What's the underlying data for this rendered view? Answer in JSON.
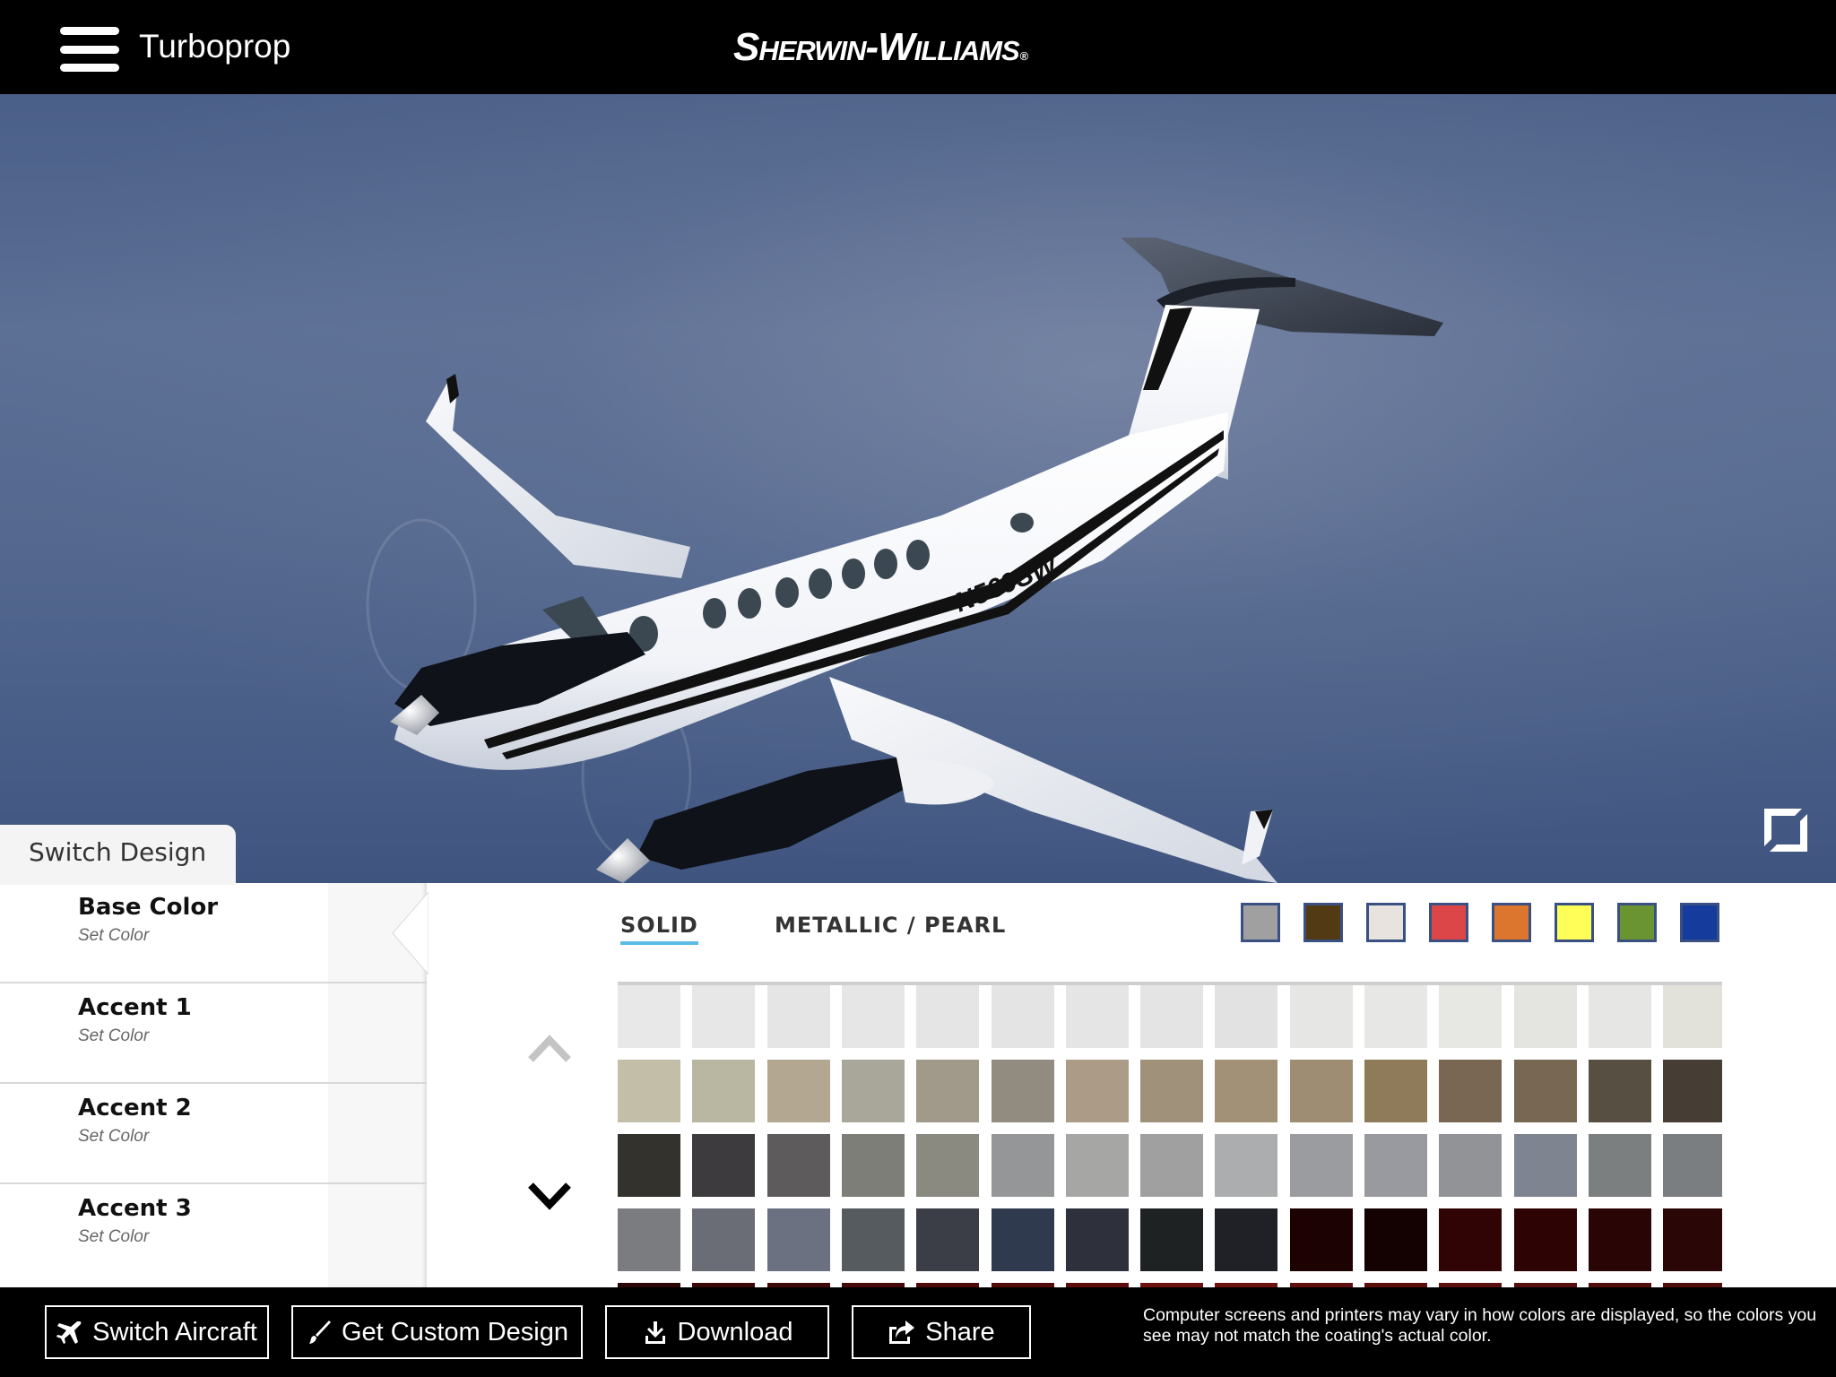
{
  "header": {
    "menu_icon": "hamburger-menu-icon",
    "title": "Turboprop",
    "brand": "Sherwin-Williams",
    "brand_mark": "®"
  },
  "viewport": {
    "aircraft_registration": "N569SW",
    "fullscreen_icon": "expand-icon",
    "switch_design_label": "Switch Design"
  },
  "sidebar": {
    "items": [
      {
        "label": "Base Color",
        "sub": "Set Color",
        "active": true
      },
      {
        "label": "Accent 1",
        "sub": "Set Color",
        "active": false
      },
      {
        "label": "Accent 2",
        "sub": "Set Color",
        "active": false
      },
      {
        "label": "Accent 3",
        "sub": "Set Color",
        "active": false
      }
    ]
  },
  "palette": {
    "tabs": [
      {
        "label": "SOLID",
        "active": true
      },
      {
        "label": "METALLIC / PEARL",
        "active": false
      }
    ],
    "accent_color": "#5bbbe4",
    "quick_filters": [
      {
        "name": "gray",
        "color": "#a0a0a0"
      },
      {
        "name": "brown",
        "color": "#523a14"
      },
      {
        "name": "white",
        "color": "#e8e3de"
      },
      {
        "name": "red",
        "color": "#dc4649"
      },
      {
        "name": "orange",
        "color": "#dc762e"
      },
      {
        "name": "yellow",
        "color": "#fefe58"
      },
      {
        "name": "green",
        "color": "#6a9432"
      },
      {
        "name": "blue",
        "color": "#153c9c"
      }
    ],
    "scroll_up_icon": "chevron-up-icon",
    "scroll_down_icon": "chevron-down-icon",
    "swatch_rows": [
      [
        "#e8e8e8",
        "#e7e7e7",
        "#e5e5e5",
        "#e6e6e6",
        "#e5e5e5",
        "#e4e4e4",
        "#e5e5e5",
        "#e4e4e4",
        "#e2e2e2",
        "#e6e6e5",
        "#e7e7e6",
        "#e7e7e4",
        "#e4e4e1",
        "#e6e6e4",
        "#e2e1da"
      ],
      [
        "#c3bea8",
        "#b9b6a1",
        "#b3a792",
        "#a9a69a",
        "#a19989",
        "#928b7f",
        "#ac9b86",
        "#a0917a",
        "#a29177",
        "#9e8d72",
        "#8f7a5a",
        "#7a6753",
        "#786753",
        "#575042",
        "#463e34"
      ],
      [
        "#33322d",
        "#3d3b3e",
        "#5d5b5b",
        "#7e7e79",
        "#8a8a80",
        "#959697",
        "#a6a6a5",
        "#a0a0a0",
        "#acadae",
        "#9a9c9f",
        "#989a9f",
        "#919397",
        "#7f8590",
        "#7c7f80",
        "#7b7e81"
      ],
      [
        "#7b7c80",
        "#6a6d76",
        "#6b7180",
        "#555b5f",
        "#3b3e46",
        "#303a4e",
        "#2e313c",
        "#1f2222",
        "#1f2126",
        "#1c0202",
        "#140101",
        "#300404",
        "#2e0303",
        "#2a0505",
        "#2a0606"
      ],
      [
        "#2a0606",
        "#3a0707",
        "#3e0808",
        "#470a0a",
        "#4d0a0a",
        "#520b0b",
        "#5e0d0d",
        "#6d130f",
        "#6a130f",
        "#5e100e",
        "#5a0f0d",
        "#5a100e",
        "#55100d",
        "#4f0f0d",
        "#4e0f0d"
      ]
    ]
  },
  "footer": {
    "buttons": [
      {
        "label": "Switch Aircraft",
        "icon": "airplane-icon"
      },
      {
        "label": "Get Custom Design",
        "icon": "paintbrush-icon"
      },
      {
        "label": "Download",
        "icon": "download-icon"
      },
      {
        "label": "Share",
        "icon": "share-icon"
      }
    ],
    "disclaimer": "Computer screens and printers may vary in how colors are displayed, so the colors you see may not match the coating's actual color."
  }
}
